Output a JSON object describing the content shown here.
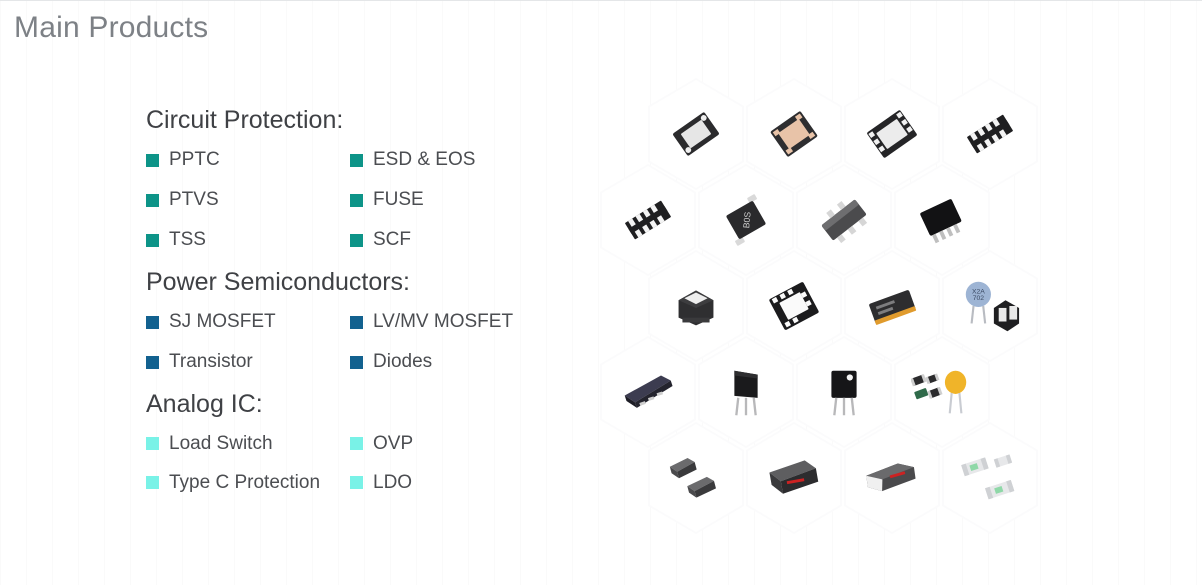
{
  "page": {
    "title": "Main Products",
    "title_color": "#7d8186",
    "background": "#ffffff"
  },
  "groups": [
    {
      "id": "circuit-protection",
      "heading": "Circuit Protection:",
      "bullet_color": "#0d9488",
      "rows": [
        {
          "left": "PPTC",
          "right": "ESD & EOS"
        },
        {
          "left": "PTVS",
          "right": "FUSE"
        },
        {
          "left": "TSS",
          "right": "SCF"
        }
      ]
    },
    {
      "id": "power-semiconductors",
      "heading": "Power Semiconductors:",
      "bullet_color": "#12618f",
      "rows": [
        {
          "left": "SJ MOSFET",
          "right": "LV/MV MOSFET"
        },
        {
          "left": "Transistor",
          "right": "Diodes"
        }
      ]
    },
    {
      "id": "analog-ic",
      "heading": "Analog IC:",
      "bullet_color": "#79f2e7",
      "rows": [
        {
          "left": "Load Switch",
          "right": "OVP"
        },
        {
          "left": "Type C Protection",
          "right": "LDO"
        }
      ]
    }
  ],
  "honeycomb": {
    "rows": 5,
    "columns": 4,
    "hex_width": 96,
    "hex_height": 112,
    "cells": [
      {
        "row": 1,
        "col": 1,
        "part": "dfn-package-dark"
      },
      {
        "row": 1,
        "col": 2,
        "part": "qfn-package-copper"
      },
      {
        "row": 1,
        "col": 3,
        "part": "dfn8-package-dark"
      },
      {
        "row": 1,
        "col": 4,
        "part": "sop-gullwing-array"
      },
      {
        "row": 2,
        "col": 1,
        "part": "sop-gullwing-array"
      },
      {
        "row": 2,
        "col": 2,
        "part": "sod-diode-marked"
      },
      {
        "row": 2,
        "col": 3,
        "part": "sot-transistor"
      },
      {
        "row": 2,
        "col": 4,
        "part": "soic8-package"
      },
      {
        "row": 3,
        "col": 1,
        "part": "power-inductor"
      },
      {
        "row": 3,
        "col": 2,
        "part": "qfn-white-pad"
      },
      {
        "row": 3,
        "col": 3,
        "part": "smd-module-orange"
      },
      {
        "row": 3,
        "col": 4,
        "part": "disc-varistor-blue"
      },
      {
        "row": 4,
        "col": 1,
        "part": "dfn-flat-board"
      },
      {
        "row": 4,
        "col": 2,
        "part": "to-220-transistor"
      },
      {
        "row": 4,
        "col": 3,
        "part": "to-220f-transistor"
      },
      {
        "row": 4,
        "col": 4,
        "part": "chip-resistors-disc-cap"
      },
      {
        "row": 5,
        "col": 1,
        "part": "smb-diode-pair"
      },
      {
        "row": 5,
        "col": 2,
        "part": "sma-diode-red"
      },
      {
        "row": 5,
        "col": 3,
        "part": "smaf-diode"
      },
      {
        "row": 5,
        "col": 4,
        "part": "ceramic-fuses"
      }
    ]
  }
}
